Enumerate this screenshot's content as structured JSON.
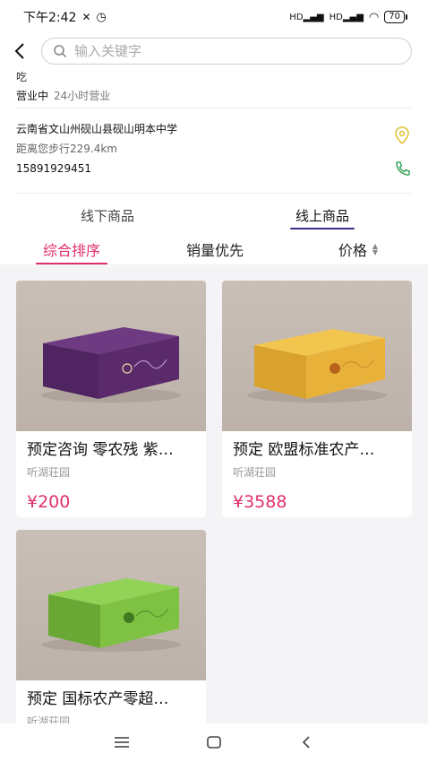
{
  "status_bar": {
    "time": "下午2:42",
    "signal1": "HD",
    "signal2": "HD",
    "battery": "70"
  },
  "search": {
    "placeholder": "输入关键字"
  },
  "shop": {
    "category": "吃",
    "status": "营业中",
    "hours": "24小时营业",
    "address": "云南省文山州砚山县砚山明本中学",
    "distance": "距离您步行229.4km",
    "phone": "15891929451"
  },
  "main_tabs": [
    {
      "label": "线下商品"
    },
    {
      "label": "线上商品"
    }
  ],
  "sort": [
    {
      "label": "综合排序"
    },
    {
      "label": "销量优先"
    },
    {
      "label": "价格"
    }
  ],
  "products": [
    {
      "name": "预定咨询 零农残 紫…",
      "shop": "听湖荘园",
      "price": "¥200",
      "box_color": "#5a2a6b"
    },
    {
      "name": "预定 欧盟标准农产…",
      "shop": "听湖荘园",
      "price": "¥3588",
      "box_color": "#e8b23a"
    },
    {
      "name": "预定 国标农产零超…",
      "shop": "听湖荘园",
      "price": "",
      "box_color": "#7fc143"
    }
  ],
  "colors": {
    "accent": "#e0306c",
    "tab_underline": "#3b2f8c",
    "location_icon": "#e3c23a",
    "phone_icon": "#3aa35a"
  }
}
